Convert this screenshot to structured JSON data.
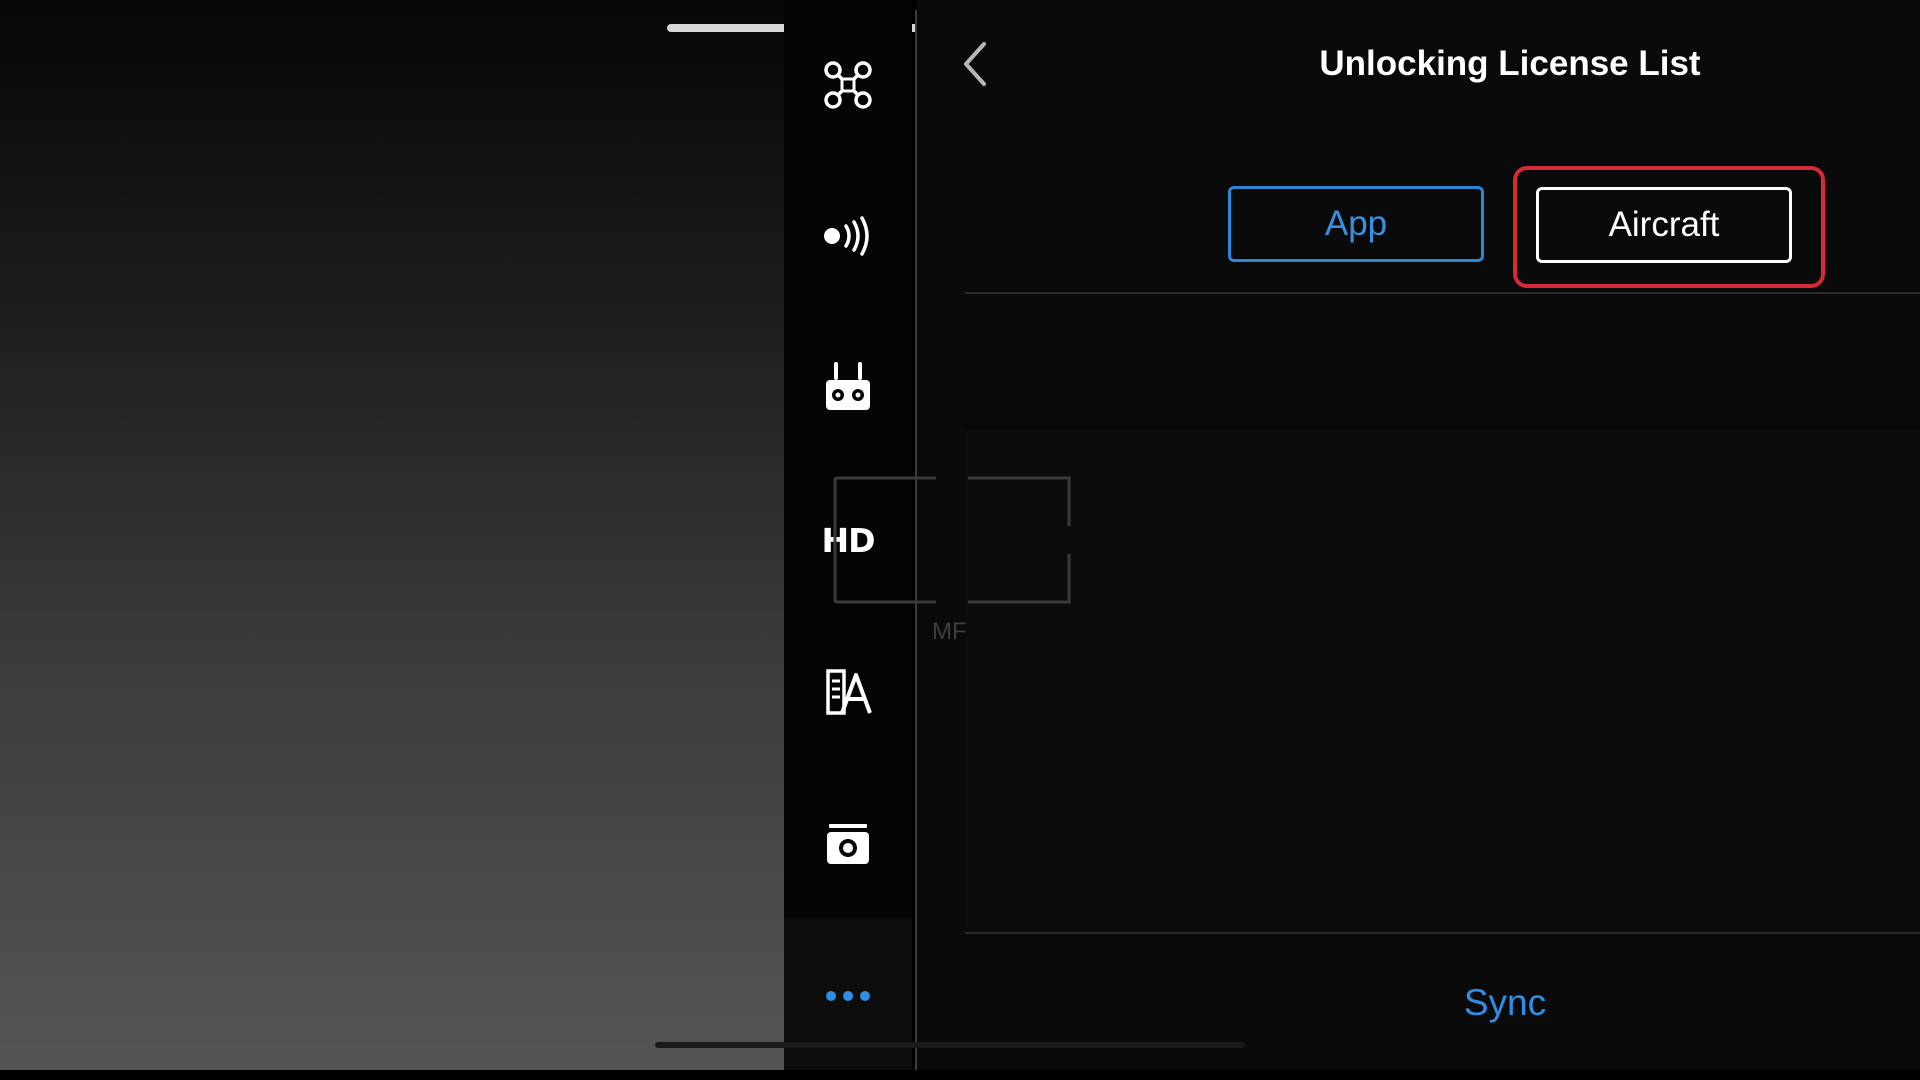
{
  "header": {
    "title": "Unlocking License List",
    "back_icon": "chevron-left-icon"
  },
  "sidebar": {
    "items": [
      {
        "name": "aircraft-settings",
        "icon": "drone-icon"
      },
      {
        "name": "sensors",
        "icon": "signal-waves-icon"
      },
      {
        "name": "remote-controller",
        "icon": "remote-controller-icon"
      },
      {
        "name": "hd-transmission",
        "icon": "hd-icon",
        "label": "HD"
      },
      {
        "name": "battery-settings",
        "icon": "battery-flag-icon"
      },
      {
        "name": "camera-settings",
        "icon": "camera-icon"
      },
      {
        "name": "more",
        "icon": "more-dots-icon"
      }
    ]
  },
  "tabs": [
    {
      "label": "App",
      "state": "inactive"
    },
    {
      "label": "Aircraft",
      "state": "selected"
    }
  ],
  "footer": {
    "sync_label": "Sync"
  },
  "camera_overlay": {
    "focus_mode": "MF"
  },
  "colors": {
    "accent_blue": "#2f8ee6",
    "highlight_red": "#d62a36",
    "panel_background": "#0a0a0a",
    "text_white": "#ffffff"
  }
}
